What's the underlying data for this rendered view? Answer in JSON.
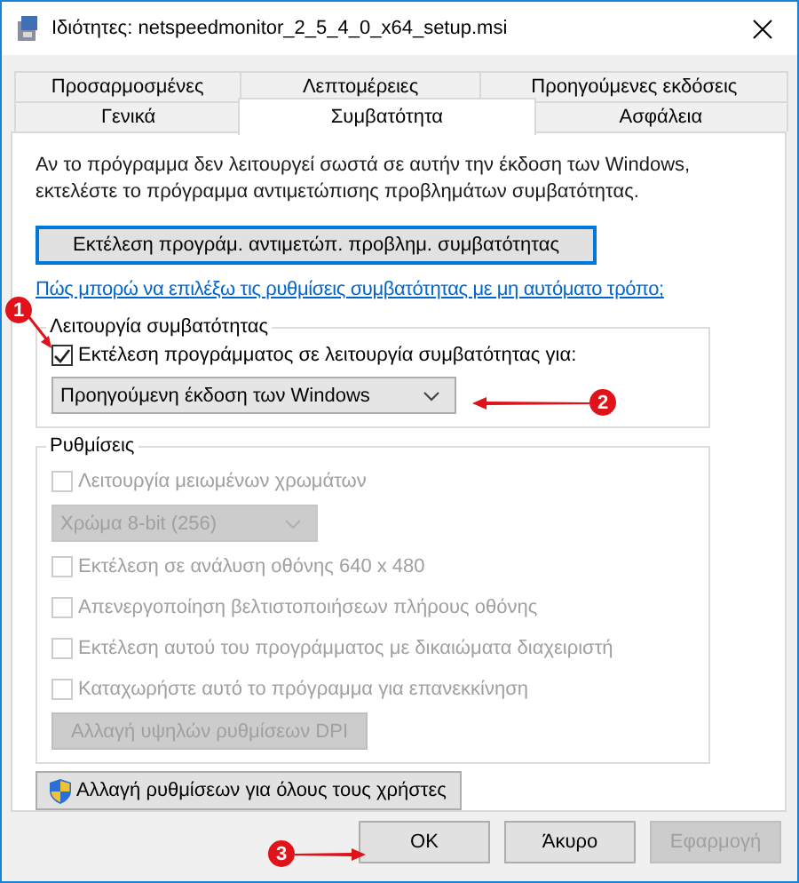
{
  "window": {
    "title": "Ιδιότητες: netspeedmonitor_2_5_4_0_x64_setup.msi"
  },
  "tab_rows": [
    [
      {
        "label": "Προσαρμοσμένες",
        "selected": false
      },
      {
        "label": "Λεπτομέρειες",
        "selected": false
      },
      {
        "label": "Προηγούμενες εκδόσεις",
        "selected": false
      }
    ],
    [
      {
        "label": "Γενικά",
        "selected": false
      },
      {
        "label": "Συμβατότητα",
        "selected": true
      },
      {
        "label": "Ασφάλεια",
        "selected": false
      }
    ]
  ],
  "description": "Αν το πρόγραμμα δεν λειτουργεί σωστά σε αυτήν την έκδοση των Windows, εκτελέστε το πρόγραμμα αντιμετώπισης προβλημάτων συμβατότητας.",
  "troubleshooter_button": {
    "label": "Εκτέλεση προγράμ. αντιμετώπ. προβλημ. συμβατότητας",
    "focused": true
  },
  "help_link": "Πώς μπορώ να επιλέξω τις ρυθμίσεις συμβατότητας με μη αυτόματο τρόπο;",
  "compatibility_mode": {
    "title": "Λειτουργία συμβατότητας",
    "checkbox": {
      "label": "Εκτέλεση προγράμματος σε λειτουργία συμβατότητας για:",
      "checked": true
    },
    "dropdown": {
      "value": "Προηγούμενη έκδοση των Windows",
      "disabled": false
    }
  },
  "settings": {
    "title": "Ρυθμίσεις",
    "items": [
      {
        "kind": "checkbox",
        "label": "Λειτουργία μειωμένων χρωμάτων",
        "checked": false,
        "disabled": true
      },
      {
        "kind": "dropdown",
        "value": "Χρώμα 8-bit (256)",
        "disabled": true
      },
      {
        "kind": "checkbox",
        "label": "Εκτέλεση σε ανάλυση οθόνης 640 x 480",
        "checked": false,
        "disabled": true
      },
      {
        "kind": "checkbox",
        "label": "Απενεργοποίηση βελτιστοποιήσεων πλήρους οθόνης",
        "checked": false,
        "disabled": true
      },
      {
        "kind": "checkbox",
        "label": "Εκτέλεση αυτού του προγράμματος με δικαιώματα διαχειριστή",
        "checked": false,
        "disabled": true
      },
      {
        "kind": "checkbox",
        "label": "Καταχωρήστε αυτό το πρόγραμμα για επανεκκίνηση",
        "checked": false,
        "disabled": true
      },
      {
        "kind": "button",
        "label": "Αλλαγή υψηλών ρυθμίσεων DPI",
        "disabled": true
      }
    ]
  },
  "all_users_button": {
    "label": "Αλλαγή ρυθμίσεων για όλους τους χρήστες"
  },
  "buttons": [
    {
      "label": "OK",
      "disabled": false
    },
    {
      "label": "Άκυρο",
      "disabled": false
    },
    {
      "label": "Εφαρμογή",
      "disabled": true
    }
  ],
  "annotations": [
    {
      "number": "1"
    },
    {
      "number": "2"
    },
    {
      "number": "3"
    }
  ]
}
